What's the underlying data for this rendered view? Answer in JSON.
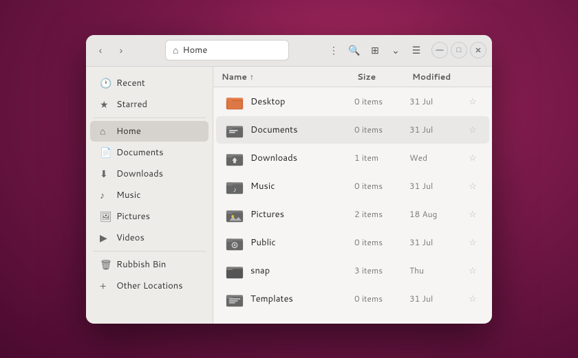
{
  "window": {
    "title": "Home",
    "address": "Home"
  },
  "titlebar": {
    "back_label": "‹",
    "forward_label": "›",
    "more_label": "⋮",
    "search_label": "🔍",
    "view_label": "⊞",
    "view_dropdown": "⌄",
    "list_label": "☰",
    "minimize_label": "—",
    "maximize_label": "□",
    "close_label": "✕"
  },
  "columns": {
    "name": "Name",
    "sort_indicator": "↑",
    "size": "Size",
    "modified": "Modified"
  },
  "sidebar": {
    "items": [
      {
        "id": "recent",
        "label": "Recent",
        "icon": "🕐"
      },
      {
        "id": "starred",
        "label": "Starred",
        "icon": "★"
      },
      {
        "id": "home",
        "label": "Home",
        "icon": "⌂",
        "active": true
      },
      {
        "id": "documents",
        "label": "Documents",
        "icon": "📄"
      },
      {
        "id": "downloads",
        "label": "Downloads",
        "icon": "⬇"
      },
      {
        "id": "music",
        "label": "Music",
        "icon": "♪"
      },
      {
        "id": "pictures",
        "label": "Pictures",
        "icon": "🖼"
      },
      {
        "id": "videos",
        "label": "Videos",
        "icon": "▶"
      },
      {
        "id": "rubbish",
        "label": "Rubbish Bin",
        "icon": "🗑"
      },
      {
        "id": "other",
        "label": "Other Locations",
        "icon": "+"
      }
    ]
  },
  "files": [
    {
      "name": "Desktop",
      "size": "0 items",
      "modified": "31 Jul",
      "starred": false,
      "type": "desktop"
    },
    {
      "name": "Documents",
      "size": "0 items",
      "modified": "31 Jul",
      "starred": false,
      "type": "documents",
      "hovered": true
    },
    {
      "name": "Downloads",
      "size": "1 item",
      "modified": "Wed",
      "starred": false,
      "type": "downloads"
    },
    {
      "name": "Music",
      "size": "0 items",
      "modified": "31 Jul",
      "starred": false,
      "type": "music"
    },
    {
      "name": "Pictures",
      "size": "2 items",
      "modified": "18 Aug",
      "starred": false,
      "type": "pictures"
    },
    {
      "name": "Public",
      "size": "0 items",
      "modified": "31 Jul",
      "starred": false,
      "type": "public"
    },
    {
      "name": "snap",
      "size": "3 items",
      "modified": "Thu",
      "starred": false,
      "type": "snap"
    },
    {
      "name": "Templates",
      "size": "0 items",
      "modified": "31 Jul",
      "starred": false,
      "type": "templates"
    }
  ]
}
